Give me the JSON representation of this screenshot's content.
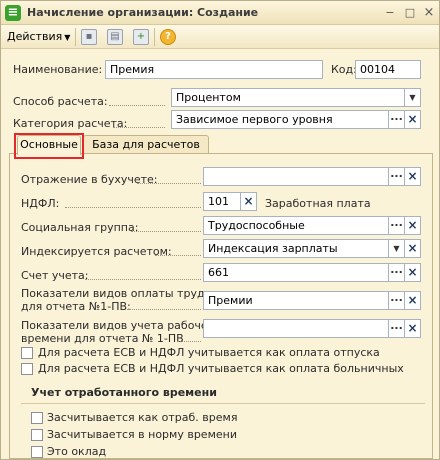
{
  "window": {
    "title": "Начисление организации: Создание",
    "icon": "app-icon",
    "controls": {
      "minimize": "−",
      "maximize": "□",
      "close": "×"
    }
  },
  "toolbar": {
    "actions_label": "Действия",
    "icons": [
      "save-icon",
      "print-icon",
      "add-icon",
      "help-icon"
    ]
  },
  "header": {
    "name_label": "Наименование:",
    "name_value": "Премия",
    "code_label": "Код:",
    "code_value": "00104",
    "calc_method_label": "Способ расчета:",
    "calc_method_value": "Процентом",
    "calc_category_label": "Категория расчета:",
    "calc_category_value": "Зависимое первого уровня"
  },
  "tabs": [
    {
      "label": "Основные",
      "active": true
    },
    {
      "label": "База для расчетов",
      "active": false
    }
  ],
  "main": {
    "accounting_label": "Отражение в бухучете:",
    "accounting_value": "",
    "ndfl_label": "НДФЛ:",
    "ndfl_code": "101",
    "ndfl_desc": "Заработная плата",
    "social_group_label": "Социальная группа:",
    "social_group_value": "Трудоспособные",
    "indexed_label": "Индексируется расчетом:",
    "indexed_value": "Индексация зарплаты",
    "account_label": "Счет учета:",
    "account_value": "661",
    "pay_types_label_1": "Показатели видов оплаты труда",
    "pay_types_label_2": "для отчета №1-ПВ:",
    "pay_types_value": "Премии",
    "worktime_label_1": "Показатели видов учета рабочего",
    "worktime_label_2": "времени для отчета № 1-ПВ",
    "worktime_value": "",
    "checkbox_vacation": "Для расчета ЕСВ и НДФЛ учитывается как оплата отпуска",
    "checkbox_sick": "Для расчета ЕСВ и НДФЛ учитывается как оплата больничных",
    "section_title": "Учет отработанного времени",
    "checkbox_worked_time": "Засчитывается как отраб. время",
    "checkbox_norm_time": "Засчитывается в норму времени",
    "checkbox_salary": "Это оклад"
  },
  "colors": {
    "window_bg": "#fbf3d8",
    "highlight": "#e3272b",
    "field_border": "#a7b3c1"
  }
}
